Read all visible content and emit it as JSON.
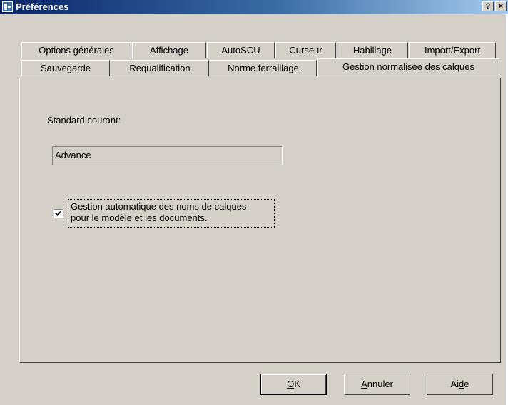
{
  "window": {
    "title": "Préférences",
    "help_label": "?",
    "close_label": "×"
  },
  "tabs_back_row": [
    {
      "label": "Options générales"
    },
    {
      "label": "Affichage"
    },
    {
      "label": "AutoSCU"
    },
    {
      "label": "Curseur"
    },
    {
      "label": "Habillage"
    },
    {
      "label": "Import/Export"
    }
  ],
  "tabs_front_row": [
    {
      "label": "Sauvegarde"
    },
    {
      "label": "Requalification"
    },
    {
      "label": "Norme ferraillage"
    },
    {
      "label": "Gestion normalisée des calques",
      "active": true
    }
  ],
  "content": {
    "standard_label": "Standard courant:",
    "standard_value": "Advance",
    "auto_checkbox_checked": true,
    "auto_checkbox_line1": "Gestion automatique des noms de calques",
    "auto_checkbox_line2": "pour le modèle et les documents."
  },
  "buttons": {
    "ok_first": "O",
    "ok_rest": "K",
    "cancel_first": "A",
    "cancel_rest": "nnuler",
    "help_pre": "Ai",
    "help_ul": "d",
    "help_post": "e"
  }
}
